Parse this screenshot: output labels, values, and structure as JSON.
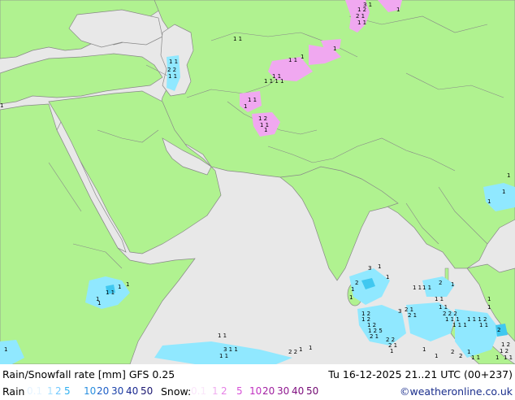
{
  "title": "Rain/Snowfall rate [mm] GFS 0.25",
  "datetime": "Tu 16-12-2025 21..21 UTC (00+237)",
  "credit": "©weatheronline.co.uk",
  "legend": {
    "rain_label": "Rain",
    "rain_values": [
      "0.1",
      "1",
      "2",
      "5",
      "10",
      "20",
      "30",
      "40",
      "50"
    ],
    "rain_colors": [
      "#e6f4ff",
      "#a8e0ff",
      "#70c8ff",
      "#30b0f0",
      "#2a90e0",
      "#1f60c8",
      "#1a40a8",
      "#182890",
      "#1a1670"
    ],
    "snow_label": "Snow:",
    "snow_values": [
      "0.1",
      "1",
      "2",
      "5",
      "10",
      "20",
      "30",
      "40",
      "50"
    ],
    "snow_colors": [
      "#fae6fa",
      "#f0b0f0",
      "#e680e6",
      "#d850d8",
      "#c030c0",
      "#a020a0",
      "#901890",
      "#801080",
      "#700870"
    ]
  },
  "colors": {
    "land": "#b0f290",
    "sea": "#e8e8e8",
    "border": "#888888",
    "rain_light": "#90e8ff",
    "rain_mid": "#40c8f0",
    "snow": "#f0a8f0"
  },
  "precip_markers": [
    "1",
    "2",
    "3",
    "5"
  ]
}
